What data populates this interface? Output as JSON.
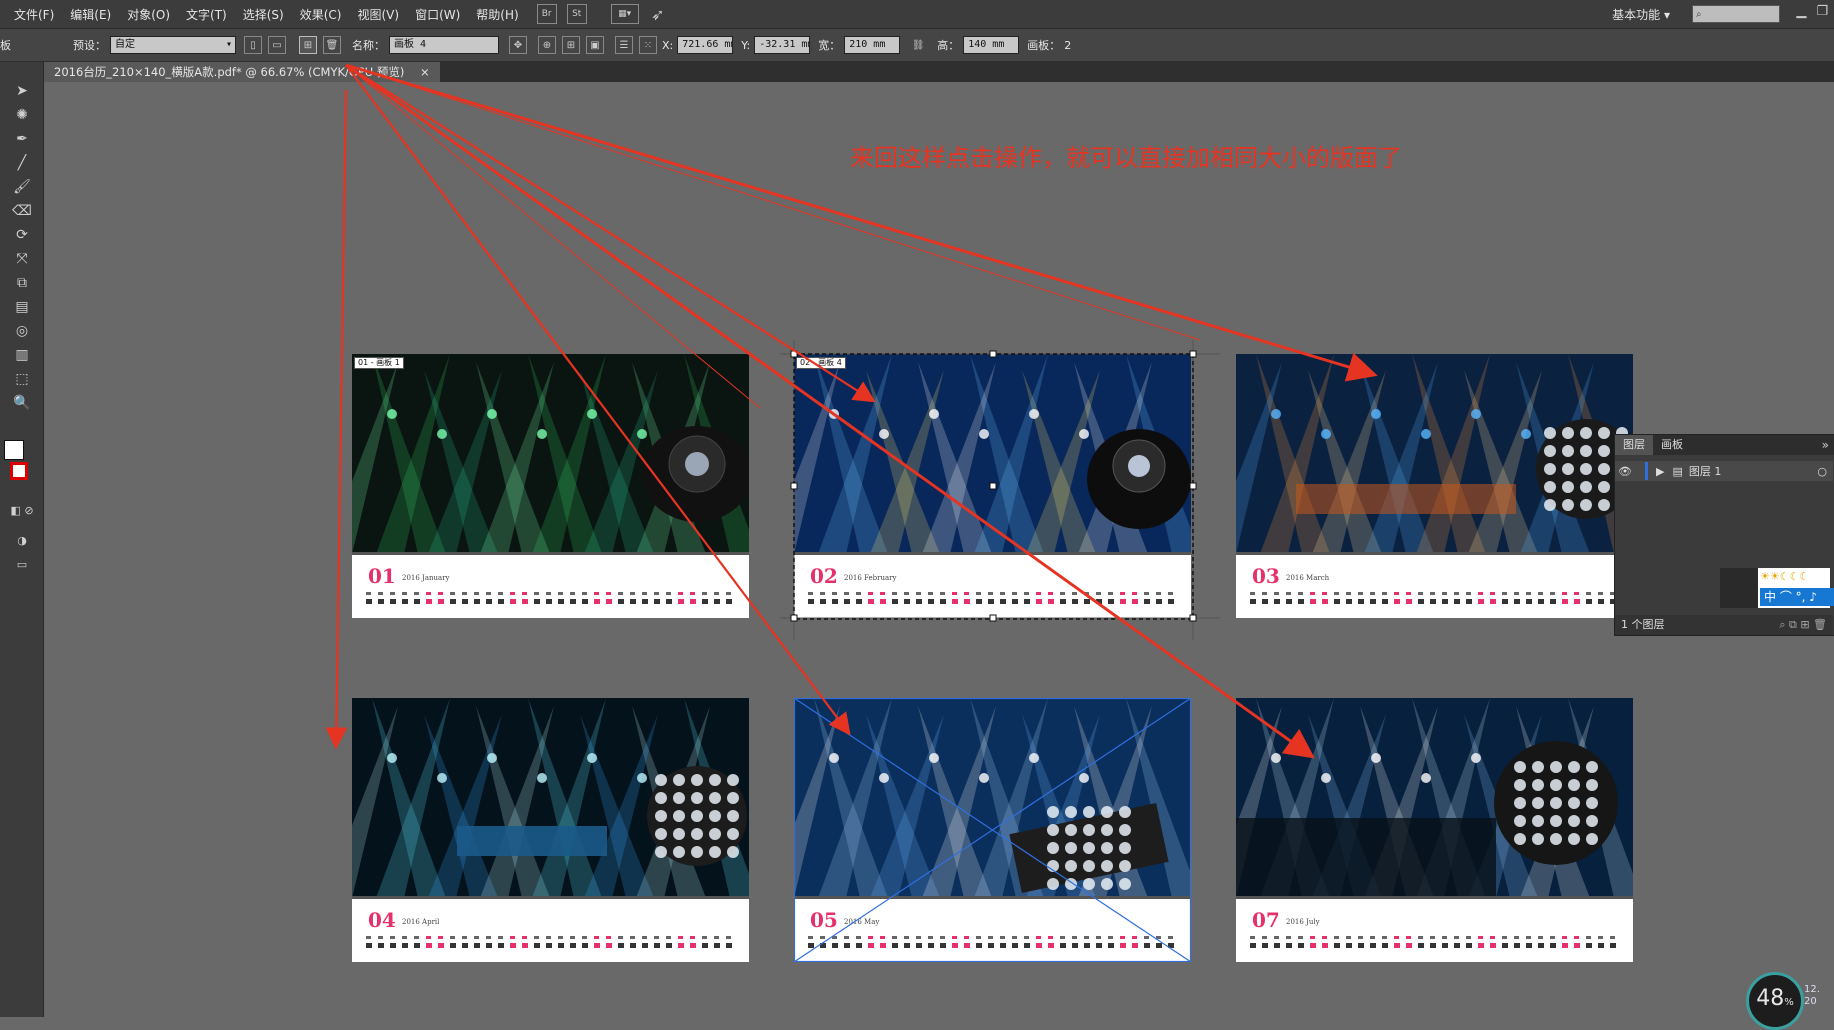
{
  "menu": [
    "文件(F)",
    "编辑(E)",
    "对象(O)",
    "文字(T)",
    "选择(S)",
    "效果(C)",
    "视图(V)",
    "窗口(W)",
    "帮助(H)"
  ],
  "menu_buttons": [
    "Br",
    "St"
  ],
  "workspace": "基本功能",
  "control": {
    "panel_stub": "板",
    "preset_label": "预设：",
    "preset_value": "自定",
    "name_label": "名称：",
    "name_value": "画板 4",
    "x_label": "X:",
    "x_value": "721.66 mm",
    "y_label": "Y:",
    "y_value": "-32.31 mm",
    "w_label": "宽：",
    "w_value": "210 mm",
    "h_label": "高：",
    "h_value": "140 mm",
    "artboard_count_label": "画板：",
    "artboard_count_value": "2"
  },
  "document_tab": {
    "title": "2016台历_210×140_横版A款.pdf* @ 66.67% (CMYK/GPU 预览)",
    "close": "×"
  },
  "annotation_text": "来回这样点击操作，就可以直接加相同大小的版面了",
  "artboards": [
    {
      "number": "01",
      "month": "2016 January",
      "label": "01 - 画板 1",
      "theme": "green",
      "selected": false,
      "crossed": false
    },
    {
      "number": "02",
      "month": "2016 February",
      "label": "02 - 画板 4",
      "theme": "blue",
      "selected": true,
      "crossed": false
    },
    {
      "number": "03",
      "month": "2016 March",
      "label": "",
      "theme": "orange",
      "selected": false,
      "crossed": false
    },
    {
      "number": "04",
      "month": "2016 April",
      "label": "",
      "theme": "cyan",
      "selected": false,
      "crossed": false
    },
    {
      "number": "05",
      "month": "2016 May",
      "label": "",
      "theme": "stage",
      "selected": false,
      "crossed": true
    },
    {
      "number": "07",
      "month": "2016 July",
      "label": "",
      "theme": "crowd",
      "selected": false,
      "crossed": false
    }
  ],
  "layers_panel": {
    "tabs": [
      "图层",
      "画板"
    ],
    "layer_name": "图层 1",
    "footer": "1 个图层"
  },
  "ime_bar": {
    "text": "中 ⌒ °, ♪"
  },
  "status_badge": {
    "value": "48",
    "unit": "%"
  },
  "corner_info": [
    "12.",
    "20"
  ],
  "colors": {
    "annotation": "#e53422",
    "accent_number": "#e6306a",
    "selection": "#2f6fe0"
  }
}
